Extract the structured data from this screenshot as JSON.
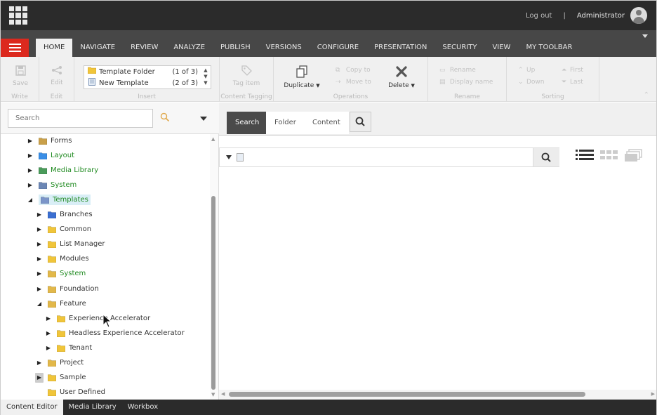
{
  "header": {
    "logout": "Log out",
    "separator": "|",
    "username": "Administrator"
  },
  "tabs": [
    "HOME",
    "NAVIGATE",
    "REVIEW",
    "ANALYZE",
    "PUBLISH",
    "VERSIONS",
    "CONFIGURE",
    "PRESENTATION",
    "SECURITY",
    "VIEW",
    "MY TOOLBAR"
  ],
  "active_tab": "HOME",
  "ribbon": {
    "write": {
      "label": "Write",
      "save": "Save"
    },
    "edit": {
      "label": "Edit",
      "edit": "Edit"
    },
    "insert": {
      "label": "Insert",
      "items": [
        {
          "name": "Template Folder",
          "count": "(1 of 3)"
        },
        {
          "name": "New Template",
          "count": "(2 of 3)"
        }
      ]
    },
    "content_tagging": {
      "label": "Content Tagging",
      "tag_item": "Tag item"
    },
    "operations": {
      "label": "Operations",
      "duplicate": "Duplicate",
      "copy_to": "Copy to",
      "move_to": "Move to",
      "delete": "Delete"
    },
    "rename": {
      "label": "Rename",
      "rename": "Rename",
      "display_name": "Display name"
    },
    "sorting": {
      "label": "Sorting",
      "up": "Up",
      "down": "Down",
      "first": "First",
      "last": "Last"
    }
  },
  "tree_search": {
    "placeholder": "Search"
  },
  "tree": [
    {
      "label": "Forms",
      "level": 0,
      "state": "collapsed",
      "icon": "forms-icon",
      "color": "#c9a04a",
      "green": false
    },
    {
      "label": "Layout",
      "level": 0,
      "state": "collapsed",
      "icon": "layout-icon",
      "color": "#3a8ee6",
      "green": true
    },
    {
      "label": "Media Library",
      "level": 0,
      "state": "collapsed",
      "icon": "media-icon",
      "color": "#4a9b5a",
      "green": true
    },
    {
      "label": "System",
      "level": 0,
      "state": "collapsed",
      "icon": "system-icon",
      "color": "#6c87b5",
      "green": true
    },
    {
      "label": "Templates",
      "level": 0,
      "state": "expanded",
      "icon": "templates-icon",
      "color": "#7b95c9",
      "green": true,
      "selected": true
    },
    {
      "label": "Branches",
      "level": 1,
      "state": "collapsed",
      "icon": "branches-icon",
      "color": "#3b6fd1",
      "green": false
    },
    {
      "label": "Common",
      "level": 1,
      "state": "collapsed",
      "icon": "folder-icon",
      "color": "#f0c53a",
      "green": false
    },
    {
      "label": "List Manager",
      "level": 1,
      "state": "collapsed",
      "icon": "folder-icon",
      "color": "#f0c53a",
      "green": false
    },
    {
      "label": "Modules",
      "level": 1,
      "state": "collapsed",
      "icon": "folder-icon",
      "color": "#f0c53a",
      "green": false
    },
    {
      "label": "System",
      "level": 1,
      "state": "collapsed",
      "icon": "folder-icon",
      "color": "#e2b84a",
      "green": true
    },
    {
      "label": "Foundation",
      "level": 1,
      "state": "collapsed",
      "icon": "folder-icon",
      "color": "#e2b84a",
      "green": false
    },
    {
      "label": "Feature",
      "level": 1,
      "state": "expanded",
      "icon": "folder-icon",
      "color": "#e2b84a",
      "green": false
    },
    {
      "label": "Experience Accelerator",
      "level": 2,
      "state": "collapsed",
      "icon": "folder-icon",
      "color": "#f0c53a",
      "green": false
    },
    {
      "label": "Headless Experience Accelerator",
      "level": 2,
      "state": "collapsed",
      "icon": "folder-icon",
      "color": "#f0c53a",
      "green": false
    },
    {
      "label": "Tenant",
      "level": 2,
      "state": "collapsed",
      "icon": "folder-icon",
      "color": "#f0c53a",
      "green": false
    },
    {
      "label": "Project",
      "level": 1,
      "state": "collapsed",
      "icon": "folder-icon",
      "color": "#e2b84a",
      "green": false
    },
    {
      "label": "Sample",
      "level": 1,
      "state": "collapsed-hover",
      "icon": "folder-icon",
      "color": "#f0c53a",
      "green": false
    },
    {
      "label": "User Defined",
      "level": 1,
      "state": "none",
      "icon": "folder-icon",
      "color": "#f0c53a",
      "green": false
    }
  ],
  "right_tabs": [
    "Search",
    "Folder",
    "Content"
  ],
  "active_right_tab": "Search",
  "bottom_tabs": [
    "Content Editor",
    "Media Library",
    "Workbox"
  ],
  "active_bottom_tab": "Content Editor",
  "colors": {
    "accent_red": "#dc291e",
    "topbar": "#2b2b2b",
    "tabbar": "#474747",
    "tree_green": "#1f8a20",
    "selected_bg": "#d9eef6"
  }
}
